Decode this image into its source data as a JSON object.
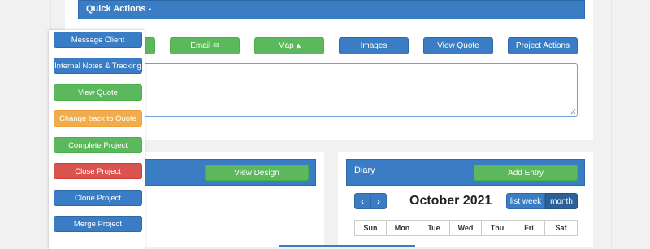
{
  "quick_actions": {
    "title": "Quick Actions -",
    "buttons": {
      "email": "Email",
      "map": "Map",
      "images": "Images",
      "view_quote": "View Quote",
      "project_actions": "Project Actions"
    }
  },
  "side_menu": {
    "items": [
      "Message Client",
      "Internal Notes & Tracking",
      "View Quote",
      "Change back to Quote",
      "Complete Project",
      "Close Project",
      "Clone Project",
      "Merge Project"
    ]
  },
  "design_panel": {
    "view_design": "View Design"
  },
  "diary": {
    "title": "Diary",
    "add_entry": "Add Entry",
    "month_title": "October 2021",
    "view_list_week": "list week",
    "view_month": "month",
    "days": [
      "Sun",
      "Mon",
      "Tue",
      "Wed",
      "Thu",
      "Fri",
      "Sat"
    ]
  },
  "colors": {
    "primary": "#3b7dc4",
    "success": "#5cb85c",
    "warning": "#f0ad4e",
    "danger": "#d9534f"
  }
}
